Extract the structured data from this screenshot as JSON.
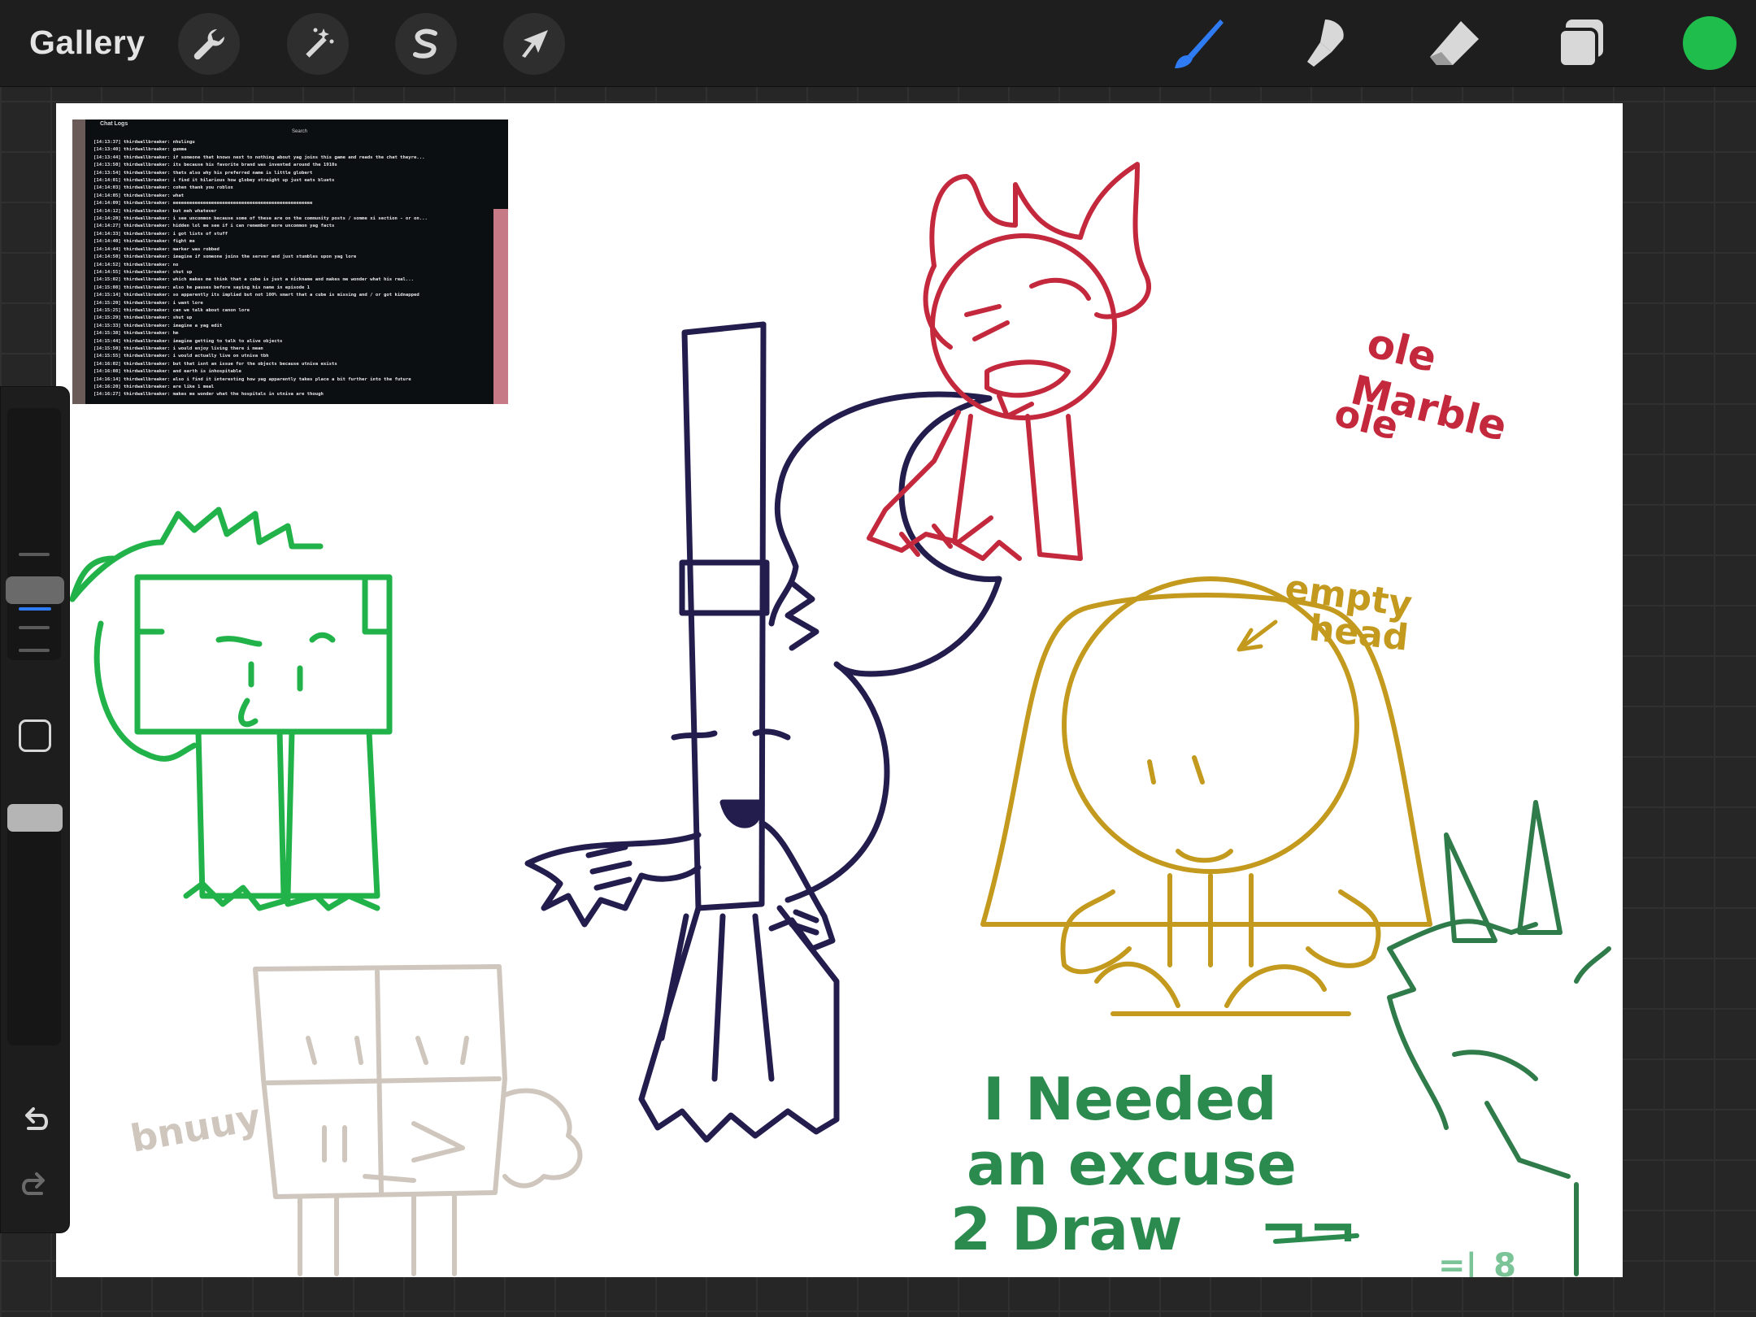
{
  "topbar": {
    "gallery_label": "Gallery",
    "left_tools": [
      "wrench-icon",
      "magic-wand-icon",
      "selection-s-icon",
      "transform-arrow-icon"
    ],
    "right_tools": [
      "brush-icon",
      "smudge-icon",
      "eraser-icon",
      "layers-icon"
    ],
    "current_color": "#1fbd4c",
    "active_tool_color": "#2f7bf3"
  },
  "canvas": {
    "photo": {
      "title": "Chat Logs",
      "search": "Search",
      "log_lines": [
        "[14:13:37] thirdwallbreaker: nhulingu",
        "[14:13:40] thirdwallbreaker: gumma",
        "[14:13:44] thirdwallbreaker: if someone that knows next to nothing about yag joins this game and reads the chat theyre...",
        "[14:13:50] thirdwallbreaker: its because his favorite brand was invented around the 1910s",
        "[14:13:54] thirdwallbreaker: thats also why his preferred name is little globert",
        "[14:14:01] thirdwallbreaker: i find it hilarious how globey straight up just eats bluets",
        "[14:14:03] thirdwallbreaker: cohen thank you roblox",
        "[14:14:05] thirdwallbreaker: what",
        "[14:14:09] thirdwallbreaker: eeeeeeeeeeeeeeeeeeeeeeeeeeeeeeeeeeeeeeeeeeeeeeeeeee",
        "[14:14:12] thirdwallbreaker: but meh whatever",
        "[14:14:20] thirdwallbreaker: i see uncommon because some of these are on the community posts / somme xi section - or on...",
        "[14:14:27] thirdwallbreaker: hidden lol me see if i can remember more uncommon yag facts",
        "[14:14:33] thirdwallbreaker: i got lists of stuff",
        "[14:14:40] thirdwallbreaker: fight me",
        "[14:14:44] thirdwallbreaker: marker was robbed",
        "[14:14:50] thirdwallbreaker: imagine if someone joins the server and just stumbles upon yag lore",
        "[14:14:52] thirdwallbreaker: no",
        "[14:14:55] thirdwallbreaker: shut up",
        "[14:15:02] thirdwallbreaker: which makes me think that a cube is just a nickname and makes me wonder what his real...",
        "[14:15:08] thirdwallbreaker: also he pauses before saying his name in episode 1",
        "[14:15:14] thirdwallbreaker: so apparently its implied but not 100% smart that a cube is missing and / or got kidnapped",
        "[14:15:20] thirdwallbreaker: i want lore",
        "[14:15:25] thirdwallbreaker: can we talk about canon lore",
        "[14:15:29] thirdwallbreaker: shut up",
        "[14:15:33] thirdwallbreaker: imagine a yag edit",
        "[14:15:38] thirdwallbreaker: hm",
        "[14:15:44] thirdwallbreaker: imagine getting to talk to alive objects",
        "[14:15:50] thirdwallbreaker: i would enjoy living there i mean",
        "[14:15:55] thirdwallbreaker: i would actually live on utniva tbh",
        "[14:16:02] thirdwallbreaker: but that isnt an issue for the objects because utniva exists",
        "[14:16:08] thirdwallbreaker: and earth is inhospitable",
        "[14:16:14] thirdwallbreaker: also i find it interesting how yag apparently takes place a bit further into the future",
        "[14:16:20] thirdwallbreaker: are like 1 meal",
        "[14:16:27] thirdwallbreaker: makes me wonder what the hospitals in utniva are though"
      ]
    },
    "annotations": {
      "ole_label_1": "ole",
      "ole_label_2": "Marble",
      "ole_label_3": "ole",
      "empty_label_1": "empty",
      "empty_label_2": "head",
      "bnuuy_label": "bnuuy",
      "needed_line_1": "I Needed",
      "needed_line_2": "an excuse",
      "needed_line_3": "2 Draw",
      "needed_emote": "¬¬",
      "signature": "=|_8"
    }
  },
  "sidebar": {
    "modify_label": "modify-square",
    "undo_icon": "undo-icon",
    "redo_icon": "redo-icon"
  }
}
